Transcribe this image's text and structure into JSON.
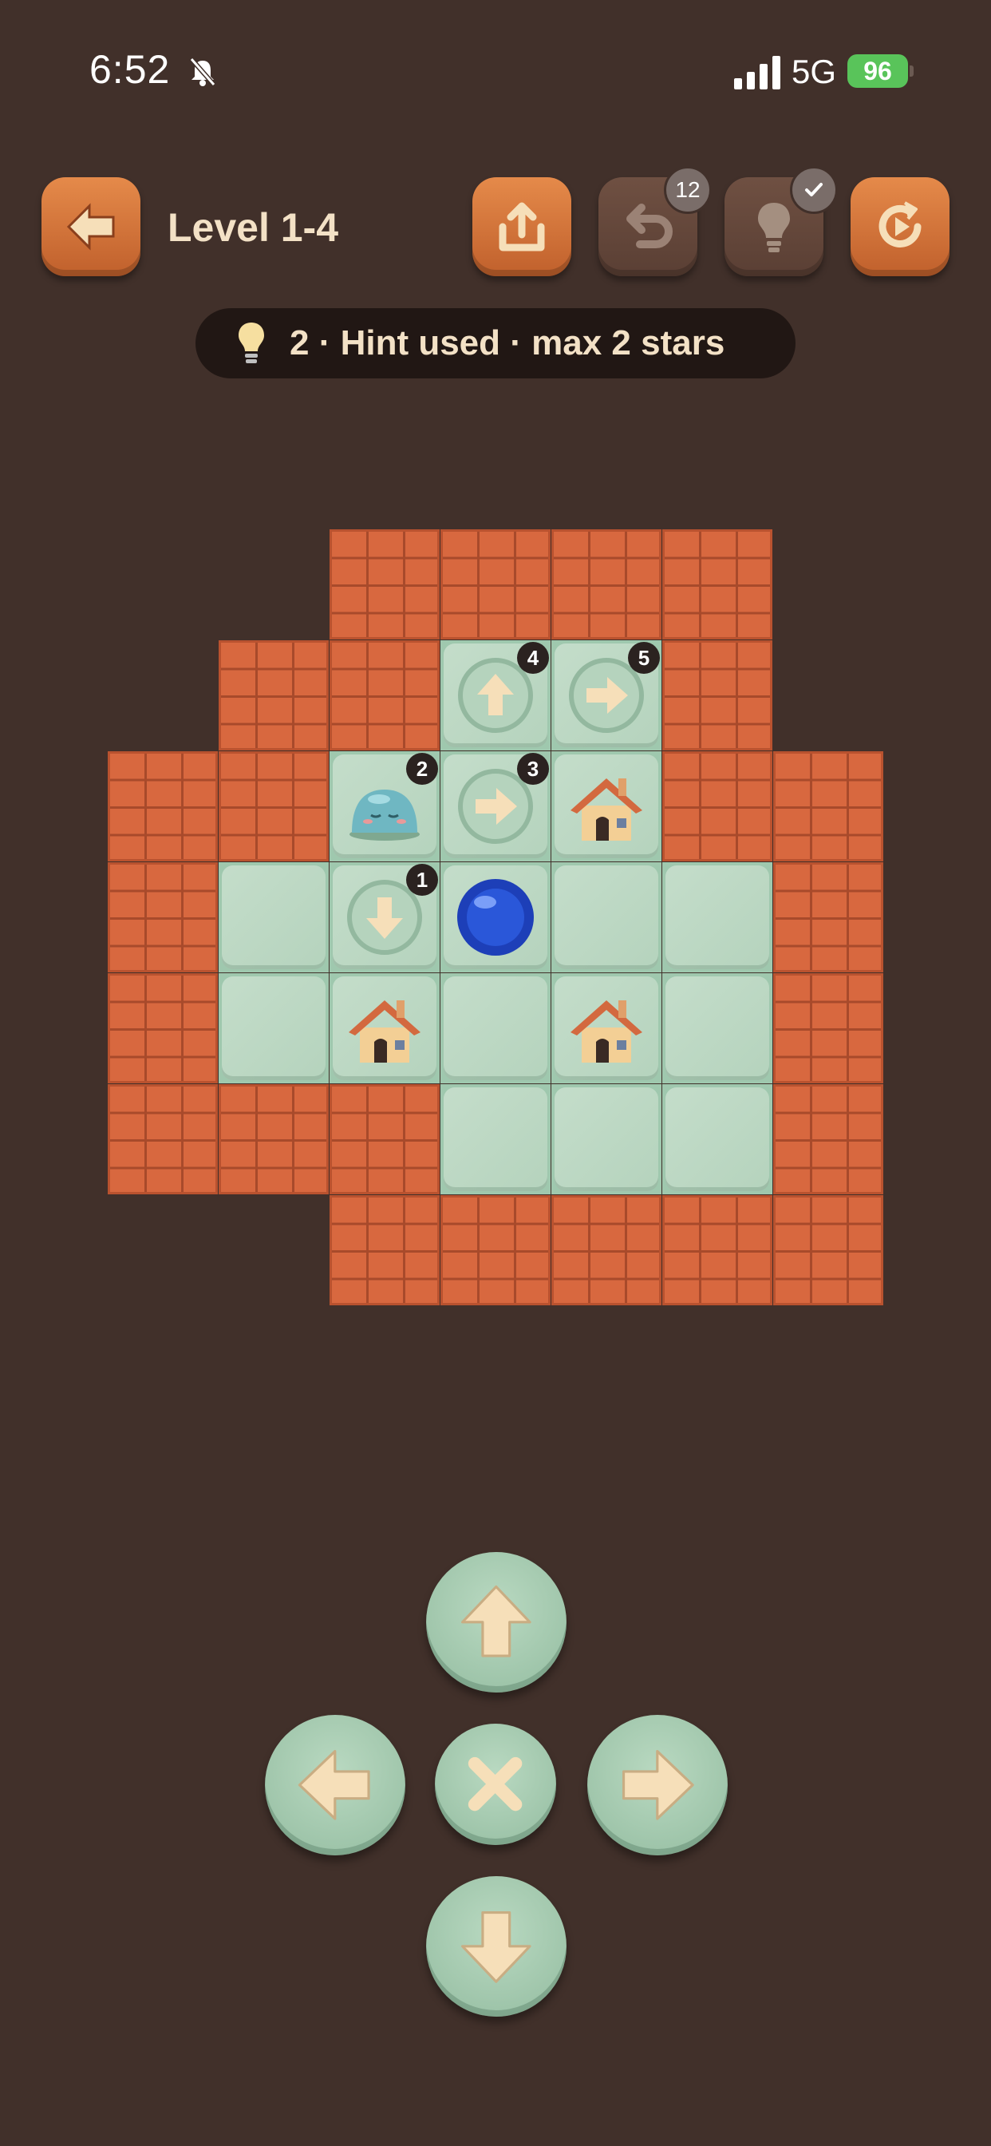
{
  "status_bar": {
    "time": "6:52",
    "network": "5G",
    "battery": "96"
  },
  "header": {
    "level_title": "Level 1-4",
    "undo_badge": "12",
    "back_icon": "arrow-left-icon",
    "share_icon": "share-icon",
    "undo_icon": "undo-icon",
    "hint_icon": "lightbulb-icon",
    "restart_icon": "restart-icon"
  },
  "hint_bar": {
    "text": "2 · Hint used · max 2 stars"
  },
  "board": {
    "step_labels": [
      "1",
      "2",
      "3",
      "4",
      "5"
    ]
  },
  "colors": {
    "background": "#41302a",
    "wall": "#d8683f",
    "floor": "#c4ddca",
    "button_orange": "#d5743c",
    "dpad_green": "#a8cdb2"
  }
}
